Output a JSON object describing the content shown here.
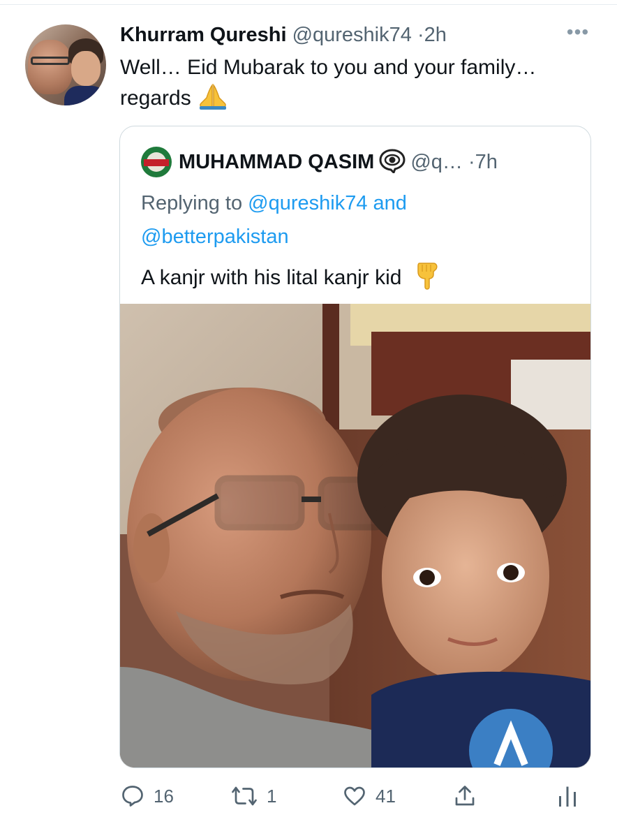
{
  "tweet": {
    "author_name": "Khurram Qureshi",
    "author_handle": "@qureshik74",
    "dot": "·",
    "time": "2h",
    "more_label": "•••",
    "text_line1": "Well… Eid Mubarak to you and your family…",
    "text_line2": "regards",
    "text_emoji": "folded-hands-emoji"
  },
  "quote": {
    "author_name": "MUHAMMAD QASIM",
    "badge_icon": "eye-in-speech-bubble-icon",
    "author_handle": "@q…",
    "dot": "·",
    "time": "7h",
    "replying_prefix": "Replying to",
    "reply_handle_1": "@qureshik74",
    "reply_and": "and",
    "reply_handle_2": "@betterpakistan",
    "text": "A kanjr with his lital kanjr kid",
    "text_emoji": "backhand-index-pointing-down-emoji",
    "photo_description_icon": "selfie-photo"
  },
  "actions": {
    "reply_count": "16",
    "retweet_count": "1",
    "like_count": "41",
    "reply_icon": "reply-icon",
    "retweet_icon": "retweet-icon",
    "like_icon": "heart-icon",
    "share_icon": "share-icon",
    "analytics_icon": "analytics-icon"
  },
  "colors": {
    "link": "#1d9bf0",
    "secondary_text": "#536471",
    "primary_text": "#0f1419",
    "border": "#cfd9de"
  }
}
